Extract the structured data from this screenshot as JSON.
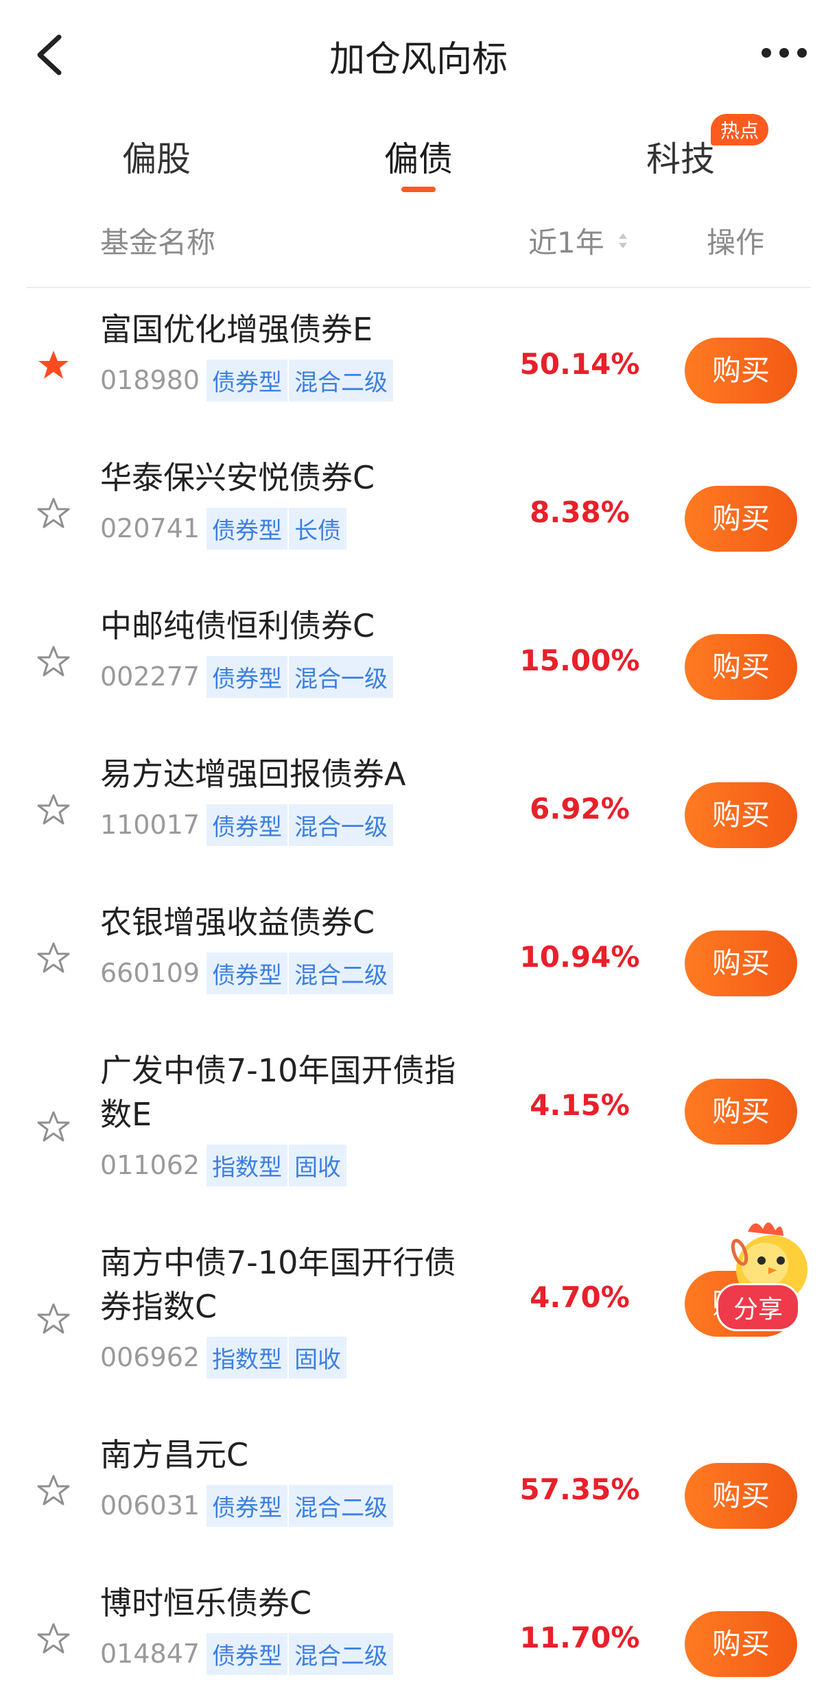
{
  "nav": {
    "title": "加仓风向标"
  },
  "tabs": [
    {
      "label": "偏股"
    },
    {
      "label": "偏债"
    },
    {
      "label": "科技"
    }
  ],
  "hot_badge": "热点",
  "header": {
    "name": "基金名称",
    "return": "近1年",
    "action": "操作"
  },
  "funds": [
    {
      "name": "富国优化增强债券E",
      "code": "018980",
      "tags": [
        "债券型",
        "混合二级"
      ],
      "return": "50.14%",
      "starred": true,
      "buy": "购买"
    },
    {
      "name": "华泰保兴安悦债券C",
      "code": "020741",
      "tags": [
        "债券型",
        "长债"
      ],
      "return": "8.38%",
      "starred": false,
      "buy": "购买"
    },
    {
      "name": "中邮纯债恒利债券C",
      "code": "002277",
      "tags": [
        "债券型",
        "混合一级"
      ],
      "return": "15.00%",
      "starred": false,
      "buy": "购买"
    },
    {
      "name": "易方达增强回报债券A",
      "code": "110017",
      "tags": [
        "债券型",
        "混合一级"
      ],
      "return": "6.92%",
      "starred": false,
      "buy": "购买"
    },
    {
      "name": "农银增强收益债券C",
      "code": "660109",
      "tags": [
        "债券型",
        "混合二级"
      ],
      "return": "10.94%",
      "starred": false,
      "buy": "购买"
    },
    {
      "name": "广发中债7-10年国开债指数E",
      "code": "011062",
      "tags": [
        "指数型",
        "固收"
      ],
      "return": "4.15%",
      "starred": false,
      "buy": "购买"
    },
    {
      "name": "南方中债7-10年国开行债券指数C",
      "code": "006962",
      "tags": [
        "指数型",
        "固收"
      ],
      "return": "4.70%",
      "starred": false,
      "buy": "购买"
    },
    {
      "name": "南方昌元C",
      "code": "006031",
      "tags": [
        "债券型",
        "混合二级"
      ],
      "return": "57.35%",
      "starred": false,
      "buy": "购买"
    },
    {
      "name": "博时恒乐债券C",
      "code": "014847",
      "tags": [
        "债券型",
        "混合二级"
      ],
      "return": "11.70%",
      "starred": false,
      "buy": "购买"
    }
  ],
  "share": {
    "label": "分享"
  },
  "colors": {
    "accent": "#ff5a1f",
    "return": "#e8202a",
    "tag_bg": "#e7f1fe",
    "tag_text": "#3c7fe0"
  }
}
